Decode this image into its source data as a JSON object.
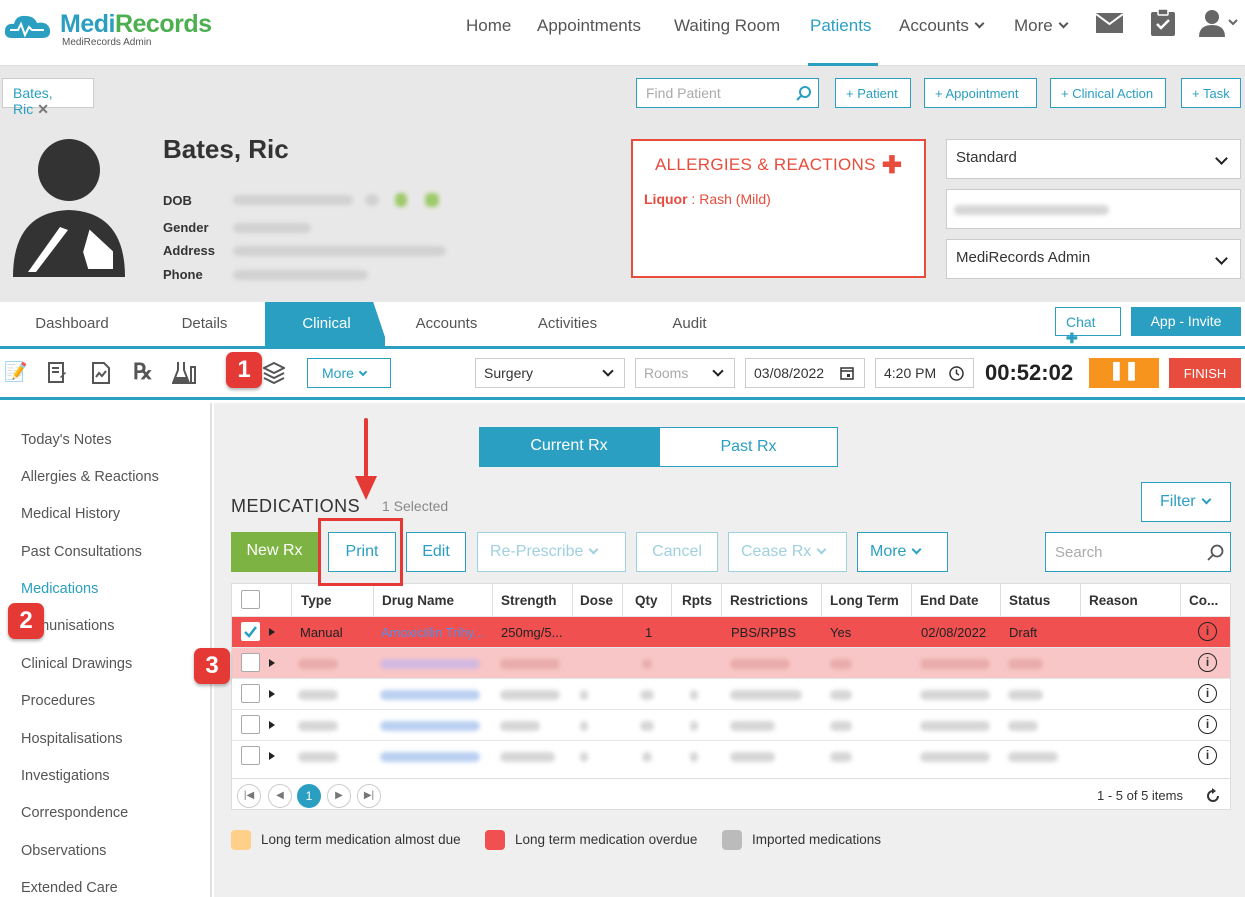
{
  "app": {
    "name_part1": "Medi",
    "name_part2": "Records",
    "subtitle": "MediRecords Admin"
  },
  "nav": {
    "items": [
      "Home",
      "Appointments",
      "Waiting Room",
      "Patients",
      "Accounts",
      "More"
    ],
    "active": "Patients"
  },
  "toolrow": {
    "patient_tab": "Bates, Ric",
    "find_placeholder": "Find Patient",
    "buttons": [
      "+ Patient",
      "+ Appointment",
      "+ Clinical Action",
      "+ Task"
    ]
  },
  "patient": {
    "name": "Bates, Ric",
    "labels": {
      "dob": "DOB",
      "gender": "Gender",
      "address": "Address",
      "phone": "Phone"
    }
  },
  "allergies": {
    "title": "ALLERGIES & REACTIONS",
    "item_name": "Liquor",
    "item_reaction": " : Rash (Mild)"
  },
  "right_selects": {
    "profile": "Standard",
    "user": "MediRecords Admin"
  },
  "tabs": [
    "Dashboard",
    "Details",
    "Clinical",
    "Accounts",
    "Activities",
    "Audit"
  ],
  "active_tab": "Clinical",
  "tab_actions": {
    "chat": "Chat",
    "app_invite": "App - Invite"
  },
  "clinical_bar": {
    "more": "More",
    "location": "Surgery",
    "rooms_placeholder": "Rooms",
    "date": "03/08/2022",
    "time": "4:20 PM",
    "timer": "00:52:02",
    "finish": "FINISH"
  },
  "sidebar": {
    "items": [
      "Today's Notes",
      "Allergies & Reactions",
      "Medical History",
      "Past Consultations",
      "Medications",
      "Immunisations",
      "Clinical Drawings",
      "Procedures",
      "Hospitalisations",
      "Investigations",
      "Correspondence",
      "Observations",
      "Extended Care"
    ],
    "active": "Medications"
  },
  "rx_toggle": {
    "current": "Current Rx",
    "past": "Past Rx"
  },
  "medications": {
    "title": "MEDICATIONS",
    "selected": "1 Selected",
    "filter": "Filter",
    "actions": {
      "new_rx": "New Rx",
      "print": "Print",
      "edit": "Edit",
      "re_prescribe": "Re-Prescribe",
      "cancel": "Cancel",
      "cease_rx": "Cease Rx",
      "more": "More"
    },
    "search_placeholder": "Search",
    "columns": [
      "Type",
      "Drug Name",
      "Strength",
      "Dose",
      "Qty",
      "Rpts",
      "Restrictions",
      "Long Term",
      "End Date",
      "Status",
      "Reason",
      "Co..."
    ],
    "rows": [
      {
        "type": "Manual",
        "drug": "Amoxicillin Trihy...",
        "strength": "250mg/5...",
        "dose": "",
        "qty": "1",
        "rpts": "",
        "restrictions": "PBS/RPBS",
        "long_term": "Yes",
        "end_date": "02/08/2022",
        "status": "Draft",
        "reason": ""
      }
    ],
    "pager": {
      "page": "1",
      "summary": "1 - 5 of 5 items"
    }
  },
  "legend": [
    "Long term medication almost due",
    "Long term medication overdue",
    "Imported medications"
  ],
  "callouts": [
    "1",
    "2",
    "3"
  ],
  "colors": {
    "accent": "#2a9fc1",
    "brand_green": "#4caf50",
    "danger": "#e74c3c",
    "new_rx": "#7cb342",
    "pause": "#f7941d"
  }
}
